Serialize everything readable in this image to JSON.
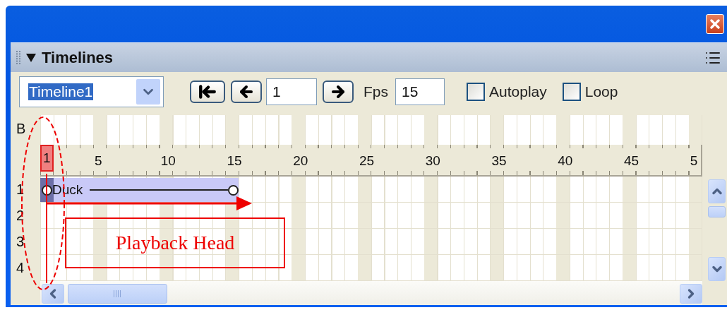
{
  "panel": {
    "title": "Timelines"
  },
  "toolbar": {
    "timeline_select": {
      "value": "Timeline1"
    },
    "frame_field": {
      "value": "1"
    },
    "fps_label": "Fps",
    "fps_field": {
      "value": "15"
    },
    "checkboxes": [
      {
        "label": "Autoplay",
        "checked": false
      },
      {
        "label": "Loop",
        "checked": false
      }
    ]
  },
  "timeline": {
    "behaviors_label": "B",
    "playback_head": {
      "label": "1"
    },
    "ruler_labels": [
      "5",
      "10",
      "15",
      "20",
      "25",
      "30",
      "35",
      "40",
      "45",
      "5"
    ],
    "layers": [
      {
        "label": "1",
        "sprites": [
          {
            "name": "Duck"
          }
        ]
      },
      {
        "label": "2"
      },
      {
        "label": "3"
      },
      {
        "label": "4"
      }
    ]
  },
  "annotation": {
    "callout": "Playback Head"
  }
}
